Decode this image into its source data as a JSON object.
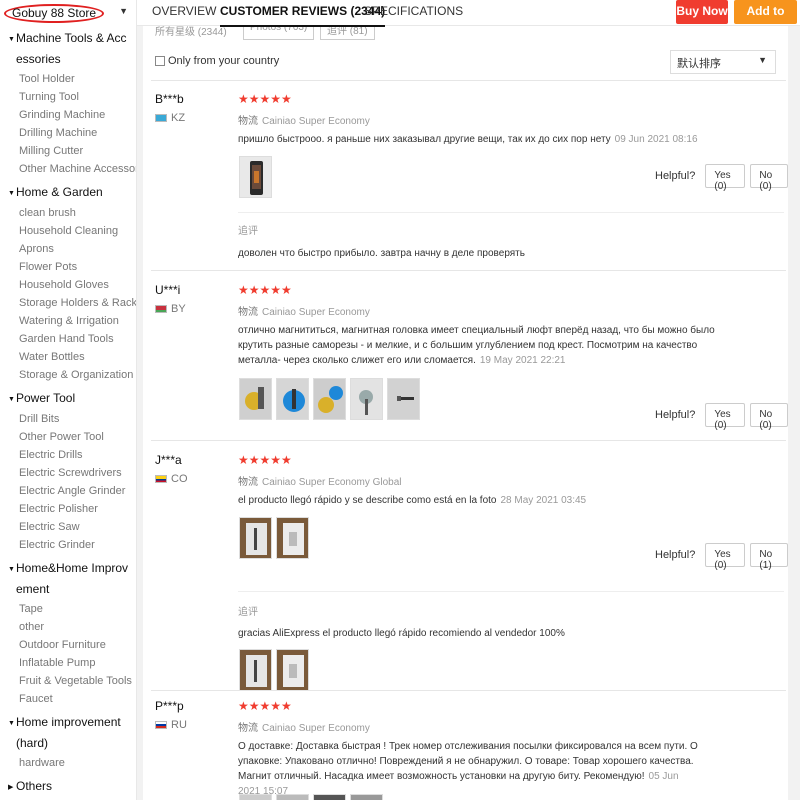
{
  "store": {
    "name": "Gobuy 88 Store"
  },
  "tabs": [
    {
      "label": "OVERVIEW"
    },
    {
      "label": "CUSTOMER REVIEWS (2344)"
    },
    {
      "label": "SPECIFICATIONS"
    }
  ],
  "actions": {
    "buy_now": "Buy Now",
    "add_to_cart": "Add to Cart"
  },
  "colors": {
    "buy": "#f03c2f",
    "cart": "#f7941d",
    "star": "#f03c2f"
  },
  "sidebar": {
    "categories": [
      {
        "title": "Machine Tools & Accessories",
        "items": [
          "Tool Holder",
          "Turning Tool",
          "Grinding Machine",
          "Drilling Machine",
          "Milling Cutter",
          "Other Machine Accessories"
        ]
      },
      {
        "title": "Home & Garden",
        "items": [
          "clean brush",
          "Household Cleaning",
          "Aprons",
          "Flower Pots",
          "Household Gloves",
          "Storage Holders & Racks",
          "Watering & Irrigation",
          "Garden Hand Tools",
          "Water Bottles",
          "Storage & Organization"
        ]
      },
      {
        "title": "Power Tool",
        "items": [
          "Drill Bits",
          "Other Power Tool",
          "Electric Drills",
          "Electric Screwdrivers",
          "Electric Angle Grinder",
          "Electric Polisher",
          "Electric Saw",
          "Electric Grinder"
        ]
      },
      {
        "title": "Home&Home Improvement",
        "items": [
          "Tape",
          "other",
          "Outdoor Furniture",
          "Inflatable Pump",
          "Fruit & Vegetable Tools",
          "Faucet"
        ]
      },
      {
        "title": "Home improvement (hard)",
        "items": [
          "hardware"
        ]
      },
      {
        "title": "Others",
        "items": []
      }
    ]
  },
  "filters": {
    "all_stars": "所有星级 (2344)",
    "photos": "Photos (763)",
    "additional": "追评 (81)",
    "only_country": "Only from your country",
    "sort": "默认排序"
  },
  "reviews": [
    {
      "user": "B***b",
      "country": "KZ",
      "stars": "★★★★★",
      "logistics_label": "物流",
      "shipping": "Cainiao Super Economy",
      "text": "пришло быстрооо. я раньше них заказывал другие вещи, так их до сих пор нету",
      "date": "09 Jun 2021 08:16",
      "helpful_label": "Helpful?",
      "yes": "Yes (0)",
      "no": "No (0)",
      "followup_label": "追评",
      "followup": "доволен что быстро прибыло. завтра начну в деле проверять"
    },
    {
      "user": "U***i",
      "country": "BY",
      "stars": "★★★★★",
      "logistics_label": "物流",
      "shipping": "Cainiao Super Economy",
      "text": "отлично магнититься, магнитная головка имеет специальный люфт вперёд назад, что бы можно было крутить разные саморезы - и мелкие, и с большим углублением под крест. Посмотрим на качество металла- через сколько слижет его или сломается.",
      "date": "19 May 2021 22:21",
      "helpful_label": "Helpful?",
      "yes": "Yes (0)",
      "no": "No (0)"
    },
    {
      "user": "J***a",
      "country": "CO",
      "stars": "★★★★★",
      "logistics_label": "物流",
      "shipping": "Cainiao Super Economy Global",
      "text": "el producto llegó rápido y se describe como está en la foto",
      "date": "28 May 2021 03:45",
      "helpful_label": "Helpful?",
      "yes": "Yes (0)",
      "no": "No (1)",
      "followup_label": "追评",
      "followup": "gracias AliExpress el producto llegó rápido recomiendo al vendedor 100%"
    },
    {
      "user": "P***p",
      "country": "RU",
      "stars": "★★★★★",
      "logistics_label": "物流",
      "shipping": "Cainiao Super Economy",
      "text": "О доставке: Доставка быстрая ! Трек номер отслеживания посылки фиксировался на всем пути. О упаковке: Упаковано отлично! Повреждений я не обнаружил. О товаре: Товар хорошего качества. Магнит отличный. Насадка имеет возможность установки на другую биту. Рекомендую!",
      "date": "05 Jun 2021 15:07"
    }
  ]
}
